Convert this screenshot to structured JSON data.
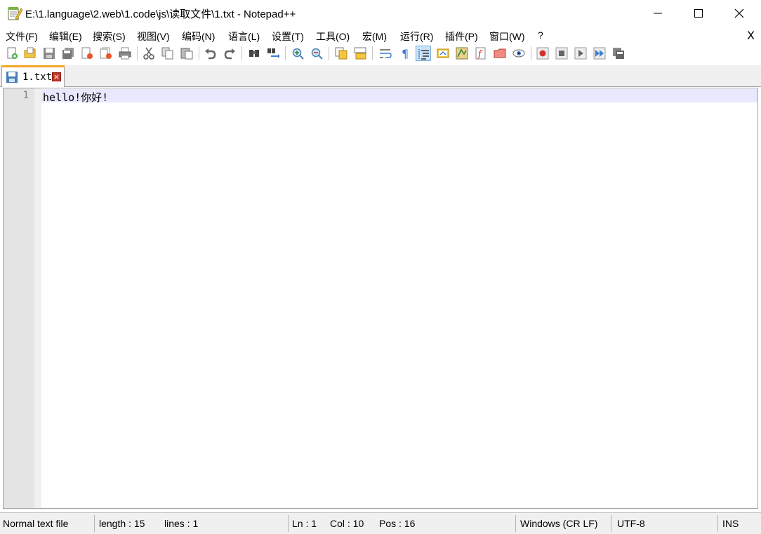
{
  "window": {
    "title": "E:\\1.language\\2.web\\1.code\\js\\读取文件\\1.txt - Notepad++",
    "minimize_icon": "minimize-icon",
    "maximize_icon": "maximize-icon",
    "close_icon": "close-icon"
  },
  "menu": {
    "items": [
      "文件(F)",
      "编辑(E)",
      "搜索(S)",
      "视图(V)",
      "编码(N)",
      "语言(L)",
      "设置(T)",
      "工具(O)",
      "宏(M)",
      "运行(R)",
      "插件(P)",
      "窗口(W)",
      "?"
    ],
    "close_label": "X"
  },
  "toolbar": {
    "icons": [
      "new-file-icon",
      "open-file-icon",
      "save-icon",
      "save-all-icon",
      "close-icon",
      "close-all-icon",
      "print-icon",
      "cut-icon",
      "copy-icon",
      "paste-icon",
      "undo-icon",
      "redo-icon",
      "find-icon",
      "replace-icon",
      "zoom-in-icon",
      "zoom-out-icon",
      "sync-vertical-icon",
      "sync-horizontal-icon",
      "word-wrap-icon",
      "show-all-characters-icon",
      "indent-guide-icon",
      "user-language-icon",
      "document-map-icon",
      "function-list-icon",
      "folder-as-workspace-icon",
      "monitoring-icon",
      "record-macro-icon",
      "stop-macro-icon",
      "play-macro-icon",
      "run-macro-multiple-icon",
      "save-macro-icon"
    ]
  },
  "tab": {
    "label": "1.txt",
    "close_label": "×"
  },
  "editor": {
    "line_number": "1",
    "content": "hello!你好!"
  },
  "statusbar": {
    "file_type": "Normal text file",
    "length": "length : 15",
    "lines": "lines : 1",
    "ln": "Ln : 1",
    "col": "Col : 10",
    "pos": "Pos : 16",
    "eol": "Windows (CR LF)",
    "encoding": "UTF-8",
    "mode": "INS"
  }
}
